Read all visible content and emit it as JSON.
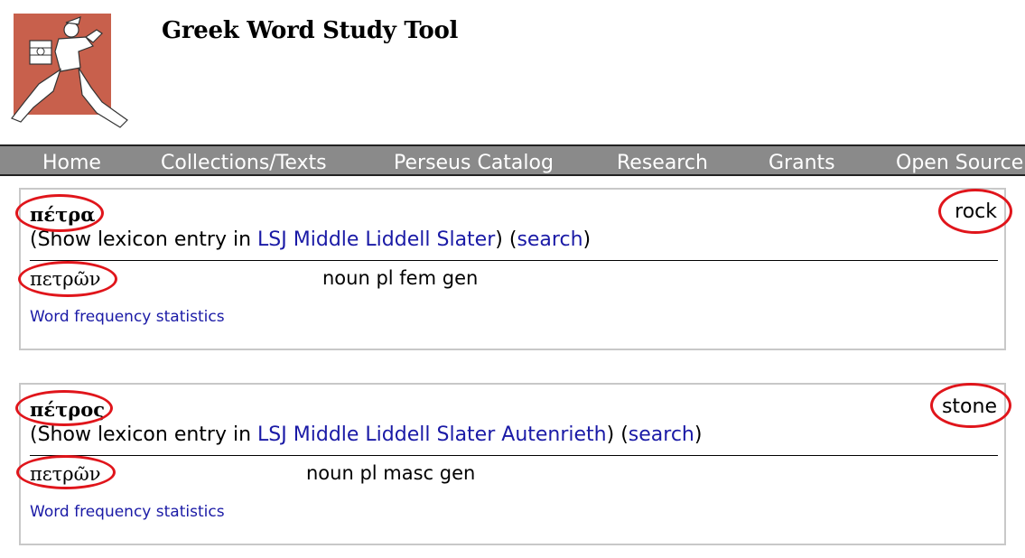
{
  "header": {
    "title": "Greek Word Study Tool",
    "logo_colors": {
      "background": "#c8604c",
      "figure": "#ffffff"
    }
  },
  "nav": {
    "items": [
      "Home",
      "Collections/Texts",
      "Perseus Catalog",
      "Research",
      "Grants",
      "Open Source"
    ],
    "background": "#8a8a8a"
  },
  "entries": [
    {
      "lemma": "πέτρα",
      "gloss": "rock",
      "lex_prefix": "(Show lexicon entry in",
      "lexicons": [
        "LSJ",
        "Middle Liddell",
        "Slater"
      ],
      "lex_mid": ") (",
      "search": "search",
      "lex_suffix": ")",
      "form": "πετρῶν",
      "parse": "noun pl fem gen",
      "freq": "Word frequency statistics"
    },
    {
      "lemma": "πέτρος",
      "gloss": "stone",
      "lex_prefix": "(Show lexicon entry in",
      "lexicons": [
        "LSJ",
        "Middle Liddell",
        "Slater",
        "Autenrieth"
      ],
      "lex_mid": ") (",
      "search": "search",
      "lex_suffix": ")",
      "form": "πετρῶν",
      "parse": "noun pl masc gen",
      "freq": "Word frequency statistics"
    }
  ],
  "colors": {
    "link": "#1a1aa6",
    "annotation": "#e0151b",
    "box_border": "#c8c8c8"
  }
}
